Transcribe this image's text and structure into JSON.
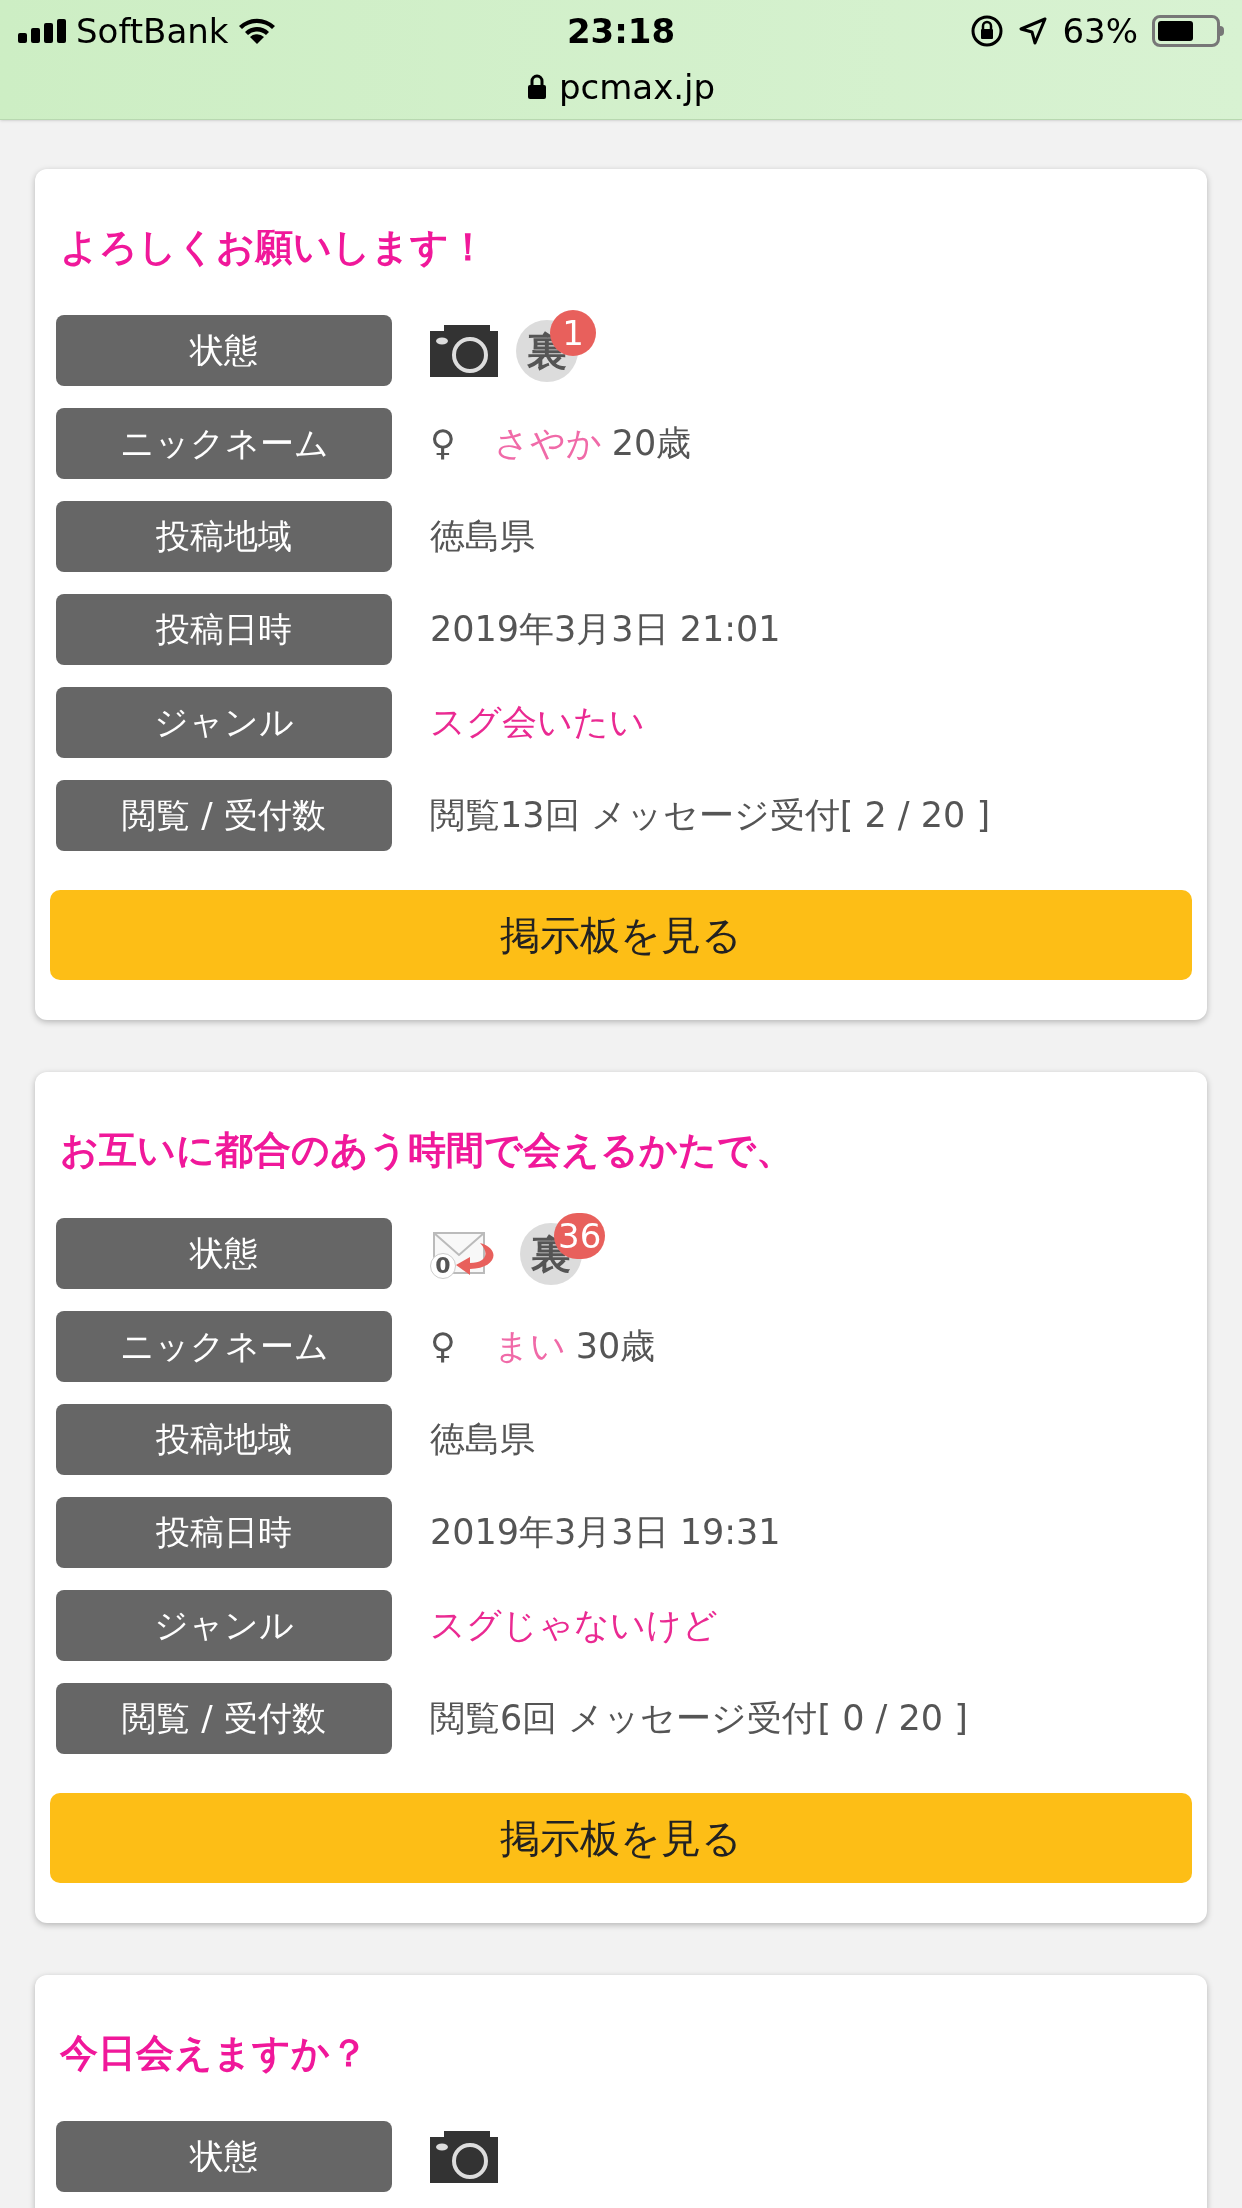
{
  "status_bar": {
    "carrier": "SoftBank",
    "time": "23:18",
    "battery": "63%"
  },
  "address_bar": {
    "url": "pcmax.jp"
  },
  "posts": [
    {
      "title": "よろしくお願いします！",
      "rows": [
        {
          "kind": "status",
          "label": "状態",
          "icons": [
            {
              "kind": "camera"
            },
            {
              "kind": "ura",
              "glyph": "裏",
              "badge": "1"
            }
          ]
        },
        {
          "kind": "nickname",
          "label": "ニックネーム",
          "sign": "♀",
          "name": "さやか",
          "age": "20歳"
        },
        {
          "kind": "text",
          "label": "投稿地域",
          "value": "徳島県"
        },
        {
          "kind": "text",
          "label": "投稿日時",
          "value": "2019年3月3日 21:01"
        },
        {
          "kind": "link",
          "label": "ジャンル",
          "value": "スグ会いたい"
        },
        {
          "kind": "text",
          "label": "閲覧 / 受付数",
          "value": "閲覧13回 メッセージ受付[ 2 / 20 ]"
        }
      ],
      "button": "掲示板を見る"
    },
    {
      "title": "お互いに都合のあう時間で会えるかたで、",
      "rows": [
        {
          "kind": "status",
          "label": "状態",
          "icons": [
            {
              "kind": "mail",
              "count": "0"
            },
            {
              "kind": "ura",
              "glyph": "裏",
              "badge": "36"
            }
          ]
        },
        {
          "kind": "nickname",
          "label": "ニックネーム",
          "sign": "♀",
          "name": "まい",
          "age": "30歳"
        },
        {
          "kind": "text",
          "label": "投稿地域",
          "value": "徳島県"
        },
        {
          "kind": "text",
          "label": "投稿日時",
          "value": "2019年3月3日 19:31"
        },
        {
          "kind": "link",
          "label": "ジャンル",
          "value": "スグじゃないけど"
        },
        {
          "kind": "text",
          "label": "閲覧 / 受付数",
          "value": "閲覧6回 メッセージ受付[ 0 / 20 ]"
        }
      ],
      "button": "掲示板を見る"
    },
    {
      "title": "今日会えますか？",
      "rows": [
        {
          "kind": "status",
          "label": "状態",
          "icons": [
            {
              "kind": "camera"
            }
          ]
        }
      ]
    }
  ]
}
